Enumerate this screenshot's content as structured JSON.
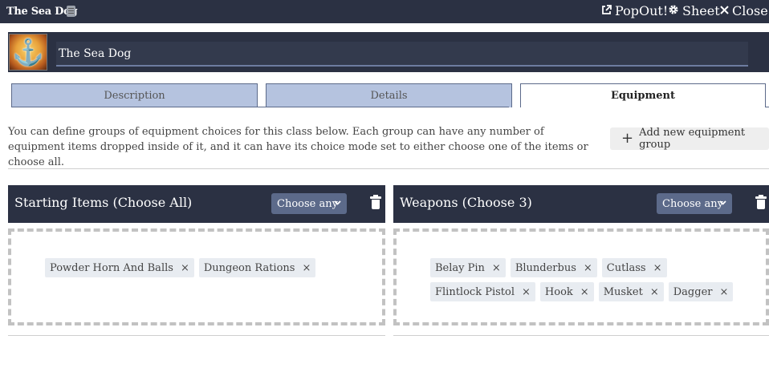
{
  "window": {
    "title": "The Sea Dog",
    "title_icon": "document-icon",
    "actions": [
      {
        "label": "PopOut!",
        "icon": "external-link-icon"
      },
      {
        "label": "Sheet",
        "icon": "gear-icon"
      },
      {
        "label": "Close",
        "icon": "close-icon"
      }
    ]
  },
  "header": {
    "avatar_icon": "anchor-icon",
    "name_value": "The Sea Dog"
  },
  "tabs": [
    {
      "label": "Description",
      "active": false
    },
    {
      "label": "Details",
      "active": false
    },
    {
      "label": "Equipment",
      "active": true
    }
  ],
  "equipment": {
    "intro": "You can define groups of equipment choices for this class below. Each group can have any number of equipment items dropped inside of it, and it can have its choice mode set to either choose one of the items or choose all.",
    "add_group_label": "Add new equipment group",
    "groups": [
      {
        "title": "Starting Items (Choose All)",
        "mode": "Choose any",
        "items": [
          "Powder Horn And Balls",
          "Dungeon Rations"
        ]
      },
      {
        "title": "Weapons (Choose 3)",
        "mode": "Choose any",
        "items": [
          "Belay Pin",
          "Blunderbus",
          "Cutlass",
          "Flintlock Pistol",
          "Hook",
          "Musket",
          "Dagger"
        ]
      }
    ],
    "remove_glyph": "×"
  },
  "colors": {
    "bar": "#2b3143",
    "tab_inactive": "#b5c3df",
    "select": "#5c6a8a",
    "chip": "#e8ecf1"
  }
}
